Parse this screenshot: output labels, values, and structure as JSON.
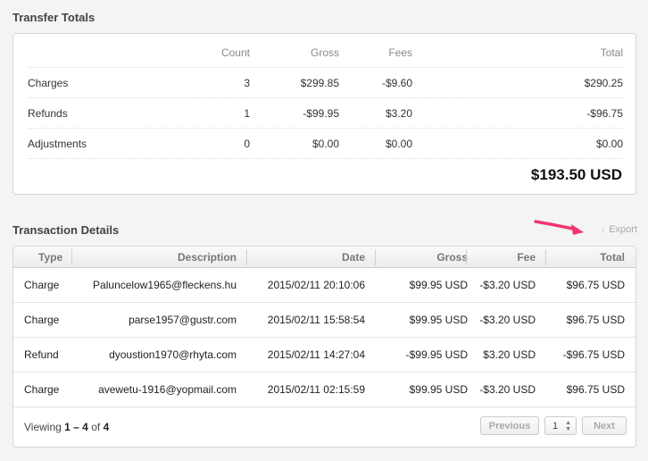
{
  "totals": {
    "title": "Transfer Totals",
    "headers": {
      "count": "Count",
      "gross": "Gross",
      "fees": "Fees",
      "total": "Total"
    },
    "rows": [
      {
        "label": "Charges",
        "count": "3",
        "gross": "$299.85",
        "fees": "-$9.60",
        "total": "$290.25"
      },
      {
        "label": "Refunds",
        "count": "1",
        "gross": "-$99.95",
        "fees": "$3.20",
        "total": "-$96.75"
      },
      {
        "label": "Adjustments",
        "count": "0",
        "gross": "$0.00",
        "fees": "$0.00",
        "total": "$0.00"
      }
    ],
    "grand_total": "$193.50 USD"
  },
  "details": {
    "title": "Transaction Details",
    "export_label": "Export",
    "export_icon": "download-icon",
    "headers": {
      "type": "Type",
      "description": "Description",
      "date": "Date",
      "gross": "Gross",
      "fee": "Fee",
      "total": "Total"
    },
    "rows": [
      {
        "type": "Charge",
        "description": "Paluncelow1965@fleckens.hu",
        "date": "2015/02/11 20:10:06",
        "gross": "$99.95 USD",
        "fee": "-$3.20 USD",
        "total": "$96.75 USD"
      },
      {
        "type": "Charge",
        "description": "parse1957@gustr.com",
        "date": "2015/02/11 15:58:54",
        "gross": "$99.95 USD",
        "fee": "-$3.20 USD",
        "total": "$96.75 USD"
      },
      {
        "type": "Refund",
        "description": "dyoustion1970@rhyta.com",
        "date": "2015/02/11 14:27:04",
        "gross": "-$99.95 USD",
        "fee": "$3.20 USD",
        "total": "-$96.75 USD"
      },
      {
        "type": "Charge",
        "description": "avewetu-1916@yopmail.com",
        "date": "2015/02/11 02:15:59",
        "gross": "$99.95 USD",
        "fee": "-$3.20 USD",
        "total": "$96.75 USD"
      }
    ],
    "footer": {
      "viewing_prefix": "Viewing",
      "range": "1 – 4",
      "of": "of",
      "count": "4",
      "previous_label": "Previous",
      "page_value": "1",
      "next_label": "Next"
    }
  },
  "colors": {
    "annotation_arrow": "#f0366d",
    "background": "#f4f4f4"
  }
}
